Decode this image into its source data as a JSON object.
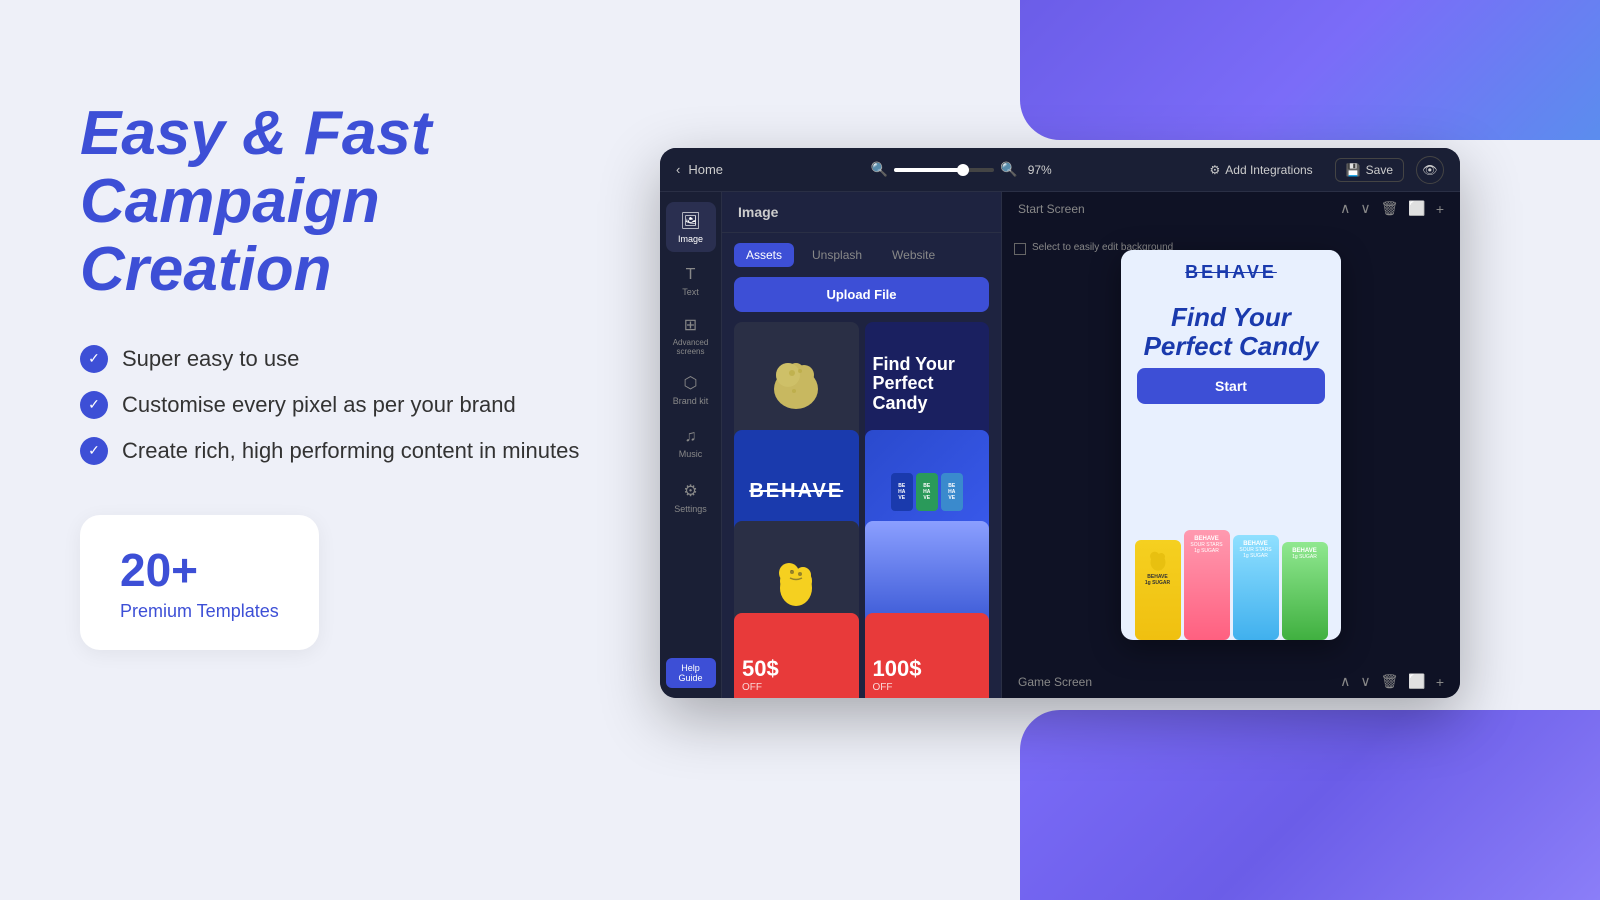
{
  "page": {
    "background_color": "#eef0f8"
  },
  "left_panel": {
    "title_line1": "Easy & Fast",
    "title_line2": "Campaign",
    "title_line3": "Creation",
    "features": [
      "Super easy to use",
      "Customise every pixel as per your brand",
      "Create rich, high performing content in minutes"
    ],
    "stats": {
      "number": "20+",
      "label": "Premium Templates"
    }
  },
  "toolbar": {
    "home_label": "Home",
    "zoom_percent": "97%",
    "add_integrations": "Add Integrations",
    "save_label": "Save"
  },
  "sidebar": {
    "items": [
      {
        "id": "image",
        "label": "Image",
        "active": true
      },
      {
        "id": "text",
        "label": "Text",
        "active": false
      },
      {
        "id": "advanced",
        "label": "Advanced screens",
        "active": false
      },
      {
        "id": "brand",
        "label": "Brand kit",
        "active": false
      },
      {
        "id": "music",
        "label": "Music",
        "active": false
      },
      {
        "id": "settings",
        "label": "Settings",
        "active": false
      }
    ],
    "help_guide": "Help Guide"
  },
  "assets_panel": {
    "title": "Image",
    "tabs": [
      {
        "id": "assets",
        "label": "Assets",
        "active": true
      },
      {
        "id": "unsplash",
        "label": "Unsplash",
        "active": false
      },
      {
        "id": "website",
        "label": "Website",
        "active": false
      }
    ],
    "upload_button": "Upload File"
  },
  "ad_preview": {
    "brand_name": "BEHAVE",
    "title_line1": "Find Your",
    "title_line2": "Perfect Candy",
    "start_button": "Start",
    "select_bg_label": "Select to easily edit background"
  },
  "screens": {
    "start_screen": "Start Screen",
    "game_screen": "Game Screen"
  },
  "promo": {
    "item1_price": "50$",
    "item1_label": "OFF",
    "item2_price": "100$",
    "item2_label": "OFF"
  },
  "candy_text": {
    "headline": "Find Your",
    "subline": "Perfect Candy"
  }
}
